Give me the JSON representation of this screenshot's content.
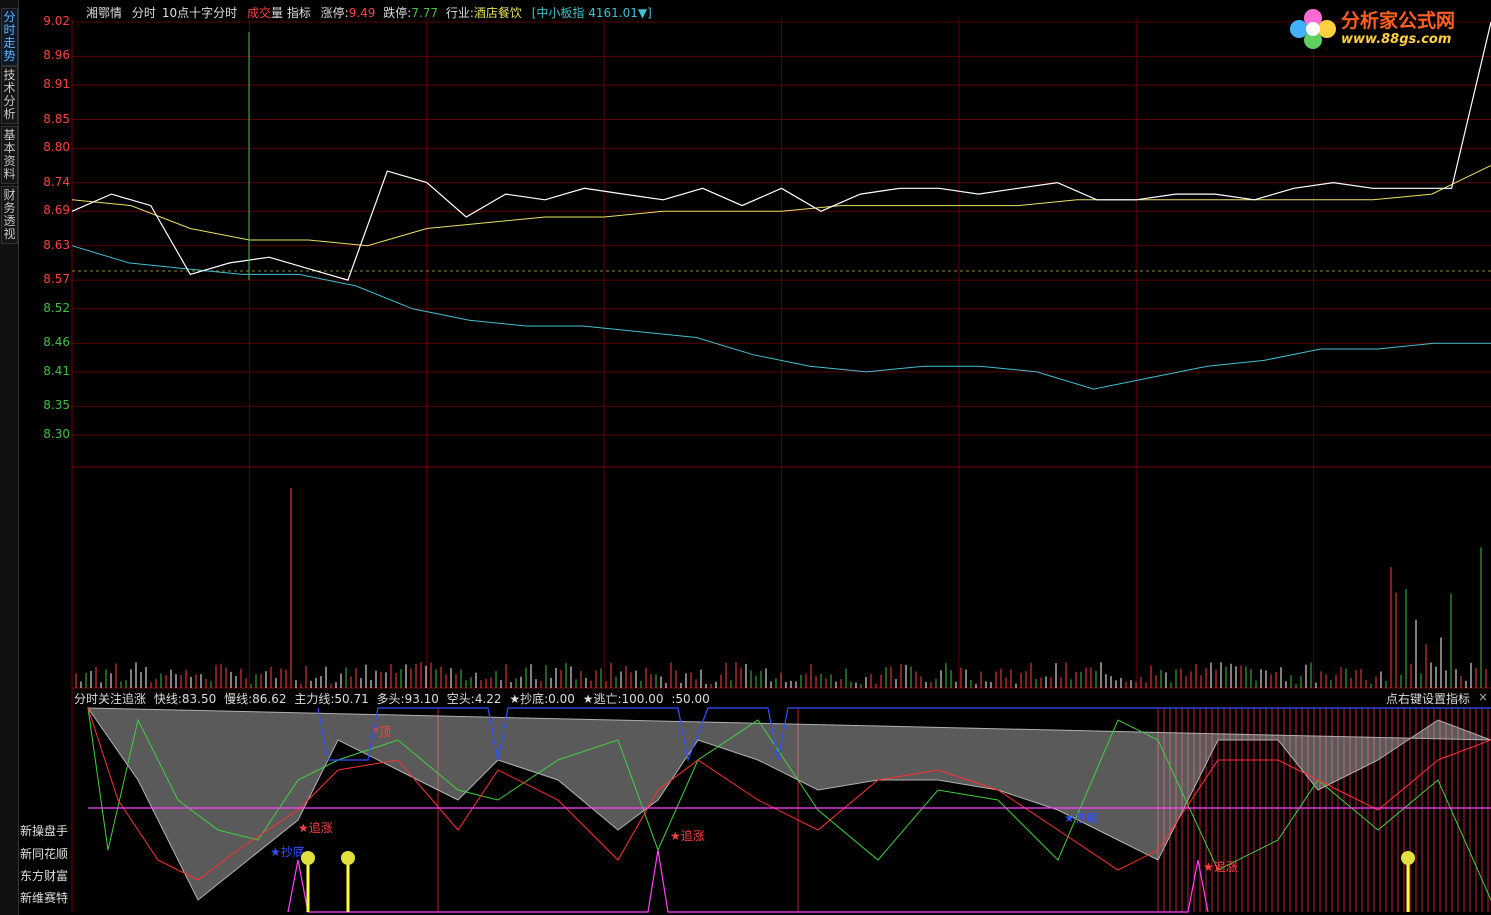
{
  "tabs": [
    "分时走势",
    "技术分析",
    "基本资料",
    "财务透视"
  ],
  "header": {
    "stock": "湘鄂情",
    "view": "分时",
    "indicator_name": "10点十字分时",
    "volume_label_a": "成交",
    "volume_label_b": "量",
    "indicator_label": "指标",
    "limit_up_label": "涨停:",
    "limit_up": "9.49",
    "limit_down_label": "跌停:",
    "limit_down": "7.77",
    "industry_label": "行业:",
    "industry": "酒店餐饮",
    "index_text": "[中小板指 4161.01▼]"
  },
  "price_axis": [
    "9.02",
    "8.96",
    "8.91",
    "8.85",
    "8.80",
    "8.74",
    "8.69",
    "8.63",
    "8.57",
    "8.52",
    "8.46",
    "8.41",
    "8.35",
    "8.30"
  ],
  "indicator_header": {
    "name": "分时关注追涨",
    "fast": "快线:83.50",
    "slow": "慢线:86.62",
    "main": "主力线:50.71",
    "bull": "多头:93.10",
    "bear": "空头:4.22",
    "bottom": "★抄底:0.00",
    "escape": "★逃亡:100.00",
    "extra": ":50.00"
  },
  "settings_link": "点右键设置指标",
  "close_symbol": "×",
  "annotations": {
    "top": "*顶",
    "chase1": "★追涨",
    "chase2": "★追涨",
    "chase3": "★追涨",
    "bottom1": "★抄底",
    "bottom2": "★抄底"
  },
  "side_menu": [
    "新操盘手",
    "新同花顺",
    "东方财富",
    "新维赛特"
  ],
  "logo": {
    "title": "分析家公式网",
    "url": "www.88gs.com"
  },
  "colors": {
    "up": "#ff4040",
    "down": "#40c040",
    "price": "#ffffff",
    "avg": "#e8e060",
    "index": "#40c0d0",
    "grid": "#5a0000"
  },
  "chart_data": {
    "type": "line",
    "series": [
      {
        "values": [
          8.69,
          8.72,
          8.7,
          8.58,
          8.6,
          8.61,
          8.59,
          8.57,
          8.76,
          8.74,
          8.68,
          8.72,
          8.71,
          8.73,
          8.72,
          8.71,
          8.73,
          8.7,
          8.73,
          8.69,
          8.72,
          8.73,
          8.73,
          8.72,
          8.73,
          8.74,
          8.71,
          8.71,
          8.72,
          8.72,
          8.71,
          8.73,
          8.74,
          8.73,
          8.73,
          8.73,
          9.02
        ]
      },
      {
        "values": [
          8.71,
          8.7,
          8.66,
          8.64,
          8.64,
          8.63,
          8.66,
          8.67,
          8.68,
          8.68,
          8.69,
          8.69,
          8.69,
          8.7,
          8.7,
          8.7,
          8.7,
          8.71,
          8.71,
          8.71,
          8.71,
          8.71,
          8.71,
          8.72,
          8.77
        ]
      },
      {
        "values": [
          8.63,
          8.6,
          8.59,
          8.58,
          8.58,
          8.56,
          8.52,
          8.5,
          8.49,
          8.49,
          8.48,
          8.47,
          8.44,
          8.42,
          8.41,
          8.42,
          8.42,
          8.41,
          8.38,
          8.4,
          8.42,
          8.43,
          8.45,
          8.45,
          8.46,
          8.46
        ]
      }
    ]
  }
}
